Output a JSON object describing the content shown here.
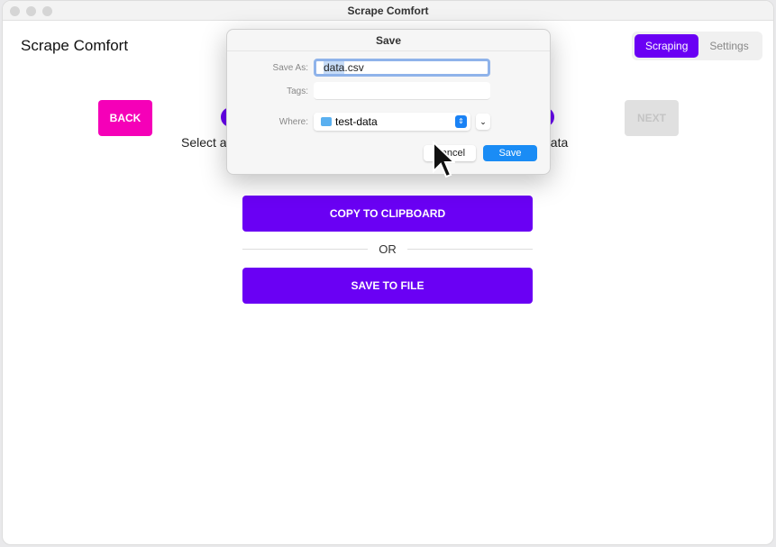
{
  "window": {
    "title": "Scrape Comfort"
  },
  "app": {
    "title": "Scrape Comfort",
    "tabs": [
      {
        "label": "Scraping",
        "active": true
      },
      {
        "label": "Settings",
        "active": false
      }
    ]
  },
  "nav": {
    "back": "BACK",
    "next": "NEXT"
  },
  "step": {
    "text_left": "Select a",
    "text_right": "data"
  },
  "actions": {
    "copy": "COPY TO CLIPBOARD",
    "or": "OR",
    "save_file": "SAVE TO FILE"
  },
  "dialog": {
    "title": "Save",
    "save_as_label": "Save As:",
    "save_as_selected": "data",
    "save_as_rest": ".csv",
    "tags_label": "Tags:",
    "tags_value": "",
    "where_label": "Where:",
    "where_value": "test-data",
    "cancel": "Cancel",
    "save": "Save"
  },
  "colors": {
    "accent": "#6a00f4",
    "back": "#f500b8",
    "dialog_save": "#1a8cf5"
  }
}
